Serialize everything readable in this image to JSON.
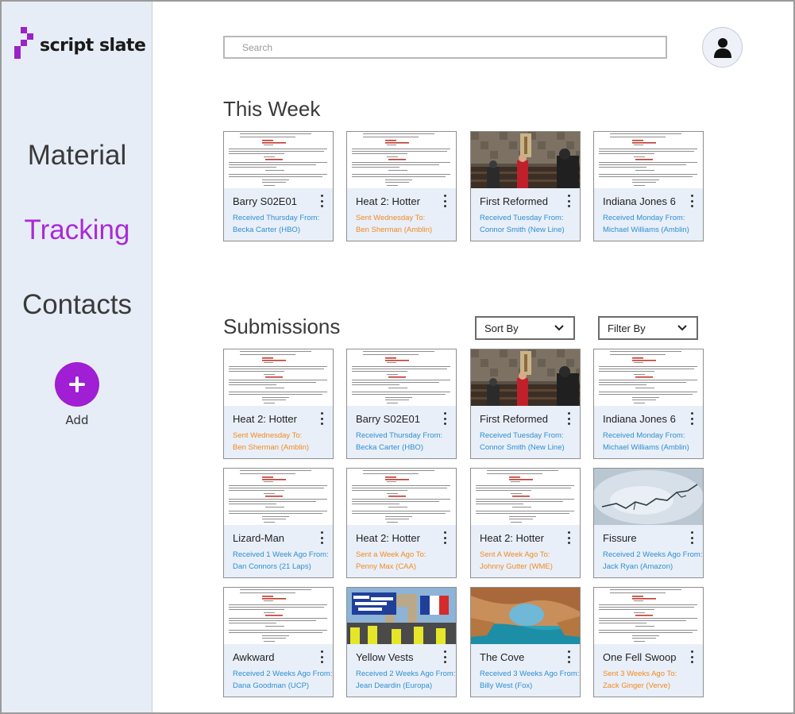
{
  "app": {
    "logo_text": "script slate"
  },
  "sidebar": {
    "items": [
      {
        "label": "Material",
        "active": false
      },
      {
        "label": "Tracking",
        "active": true
      },
      {
        "label": "Contacts",
        "active": false
      }
    ],
    "add_label": "Add"
  },
  "search": {
    "placeholder": "Search"
  },
  "sections": {
    "this_week": {
      "title": "This Week"
    },
    "submissions": {
      "title": "Submissions",
      "sort_label": "Sort By",
      "filter_label": "Filter By"
    }
  },
  "colors": {
    "accent": "#a01ed3",
    "received": "#2d8fd0",
    "sent": "#f08a24",
    "sidebar_bg": "#e7edf6",
    "card_bg": "#e9eff8"
  },
  "this_week_cards": [
    {
      "title": "Barry S02E01",
      "line1": "Received Thursday From:",
      "line2": "Becka Carter (HBO)",
      "status": "received",
      "thumb": "script"
    },
    {
      "title": "Heat 2: Hotter",
      "line1": "Sent Wednesday To:",
      "line2": "Ben Sherman (Amblin)",
      "status": "sent",
      "thumb": "script"
    },
    {
      "title": "First Reformed",
      "line1": "Received Tuesday From:",
      "line2": "Connor Smith (New Line)",
      "status": "received",
      "thumb": "church"
    },
    {
      "title": "Indiana Jones 6",
      "line1": "Received Monday From:",
      "line2": "Michael Williams (Amblin)",
      "status": "received",
      "thumb": "script"
    }
  ],
  "submission_cards": [
    {
      "title": "Heat 2: Hotter",
      "line1": "Sent Wednesday To:",
      "line2": "Ben Sherman (Amblin)",
      "status": "sent",
      "thumb": "script"
    },
    {
      "title": "Barry S02E01",
      "line1": "Received Thursday From:",
      "line2": "Becka Carter (HBO)",
      "status": "received",
      "thumb": "script"
    },
    {
      "title": "First Reformed",
      "line1": "Received Tuesday From:",
      "line2": "Connor Smith (New Line)",
      "status": "received",
      "thumb": "church"
    },
    {
      "title": "Indiana Jones 6",
      "line1": "Received Monday From:",
      "line2": "Michael Williams (Amblin)",
      "status": "received",
      "thumb": "script"
    },
    {
      "title": "Lizard-Man",
      "line1": "Received 1 Week Ago From:",
      "line2": "Dan Connors (21 Laps)",
      "status": "received",
      "thumb": "script"
    },
    {
      "title": "Heat 2: Hotter",
      "line1": "Sent a Week Ago To:",
      "line2": "Penny Max (CAA)",
      "status": "sent",
      "thumb": "script"
    },
    {
      "title": "Heat 2: Hotter",
      "line1": "Sent A Week Ago To:",
      "line2": "Johnny Gutter (WME)",
      "status": "sent",
      "thumb": "script"
    },
    {
      "title": "Fissure",
      "line1": "Received 2 Weeks Ago From:",
      "line2": "Jack Ryan (Amazon)",
      "status": "received",
      "thumb": "ice"
    },
    {
      "title": "Awkward",
      "line1": "Received 2 Weeks Ago From:",
      "line2": "Dana Goodman (UCP)",
      "status": "received",
      "thumb": "script"
    },
    {
      "title": "Yellow Vests",
      "line1": "Received 2 Weeks Ago From:",
      "line2": "Jean Deardin (Europa)",
      "status": "received",
      "thumb": "protest"
    },
    {
      "title": "The Cove",
      "line1": "Received 3 Weeks Ago From:",
      "line2": "Billy West (Fox)",
      "status": "received",
      "thumb": "cove"
    },
    {
      "title": "One Fell Swoop",
      "line1": "Sent 3 Weeks Ago To:",
      "line2": "Zack Ginger (Verve)",
      "status": "sent",
      "thumb": "script"
    }
  ]
}
